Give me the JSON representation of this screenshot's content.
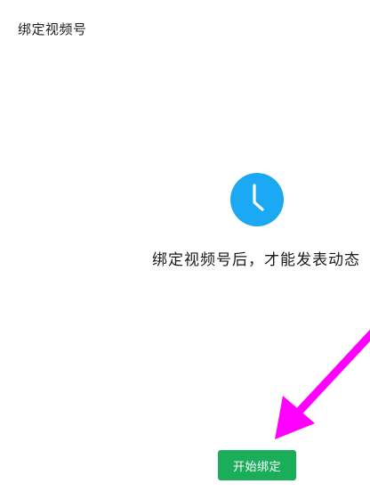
{
  "header": {
    "title": "绑定视频号"
  },
  "main": {
    "status_icon": "clock-icon",
    "message": "绑定视频号后，才能发表动态",
    "bind_button_label": "开始绑定"
  },
  "colors": {
    "icon_blue": "#1aa9f2",
    "button_green": "#1aad5a",
    "annotation_magenta": "#ff00ff"
  },
  "annotation": {
    "icon": "arrow-annotation"
  }
}
